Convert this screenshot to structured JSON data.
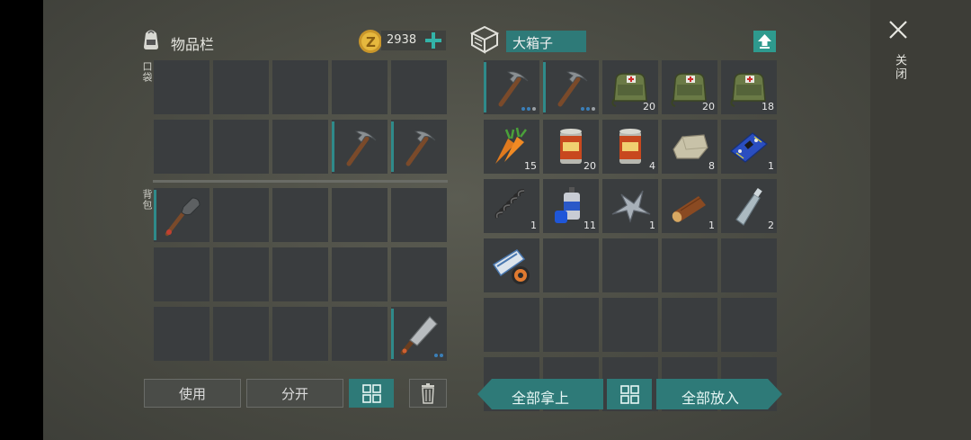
{
  "inventory": {
    "title": "物品栏",
    "coins": "2938",
    "pocket_label": "口袋",
    "backpack_label": "背包",
    "pocket_rows": [
      [
        null,
        null,
        null,
        null,
        null
      ],
      [
        null,
        null,
        null,
        {
          "icon": "pickaxe-icon",
          "dur": true
        },
        {
          "icon": "pickaxe-icon",
          "dur": true
        }
      ]
    ],
    "backpack_rows": [
      [
        {
          "icon": "shovel-icon",
          "dur": true
        },
        null,
        null,
        null,
        null
      ],
      [
        null,
        null,
        null,
        null,
        null
      ],
      [
        null,
        null,
        null,
        null,
        {
          "icon": "cleaver-icon",
          "dur": true,
          "dots": 2
        }
      ]
    ],
    "use_label": "使用",
    "split_label": "分开"
  },
  "container": {
    "title": "大箱子",
    "rows": [
      [
        {
          "icon": "pickaxe-icon",
          "dur": true,
          "dots": 3
        },
        {
          "icon": "pickaxe-icon",
          "dur": true,
          "dots": 3
        },
        {
          "icon": "medkit-bag-icon",
          "count": "20"
        },
        {
          "icon": "medkit-bag-icon",
          "count": "20"
        },
        {
          "icon": "medkit-bag-icon",
          "count": "18"
        }
      ],
      [
        {
          "icon": "carrot-icon",
          "count": "15"
        },
        {
          "icon": "canned-food-icon",
          "count": "20"
        },
        {
          "icon": "canned-food-icon",
          "count": "4"
        },
        {
          "icon": "stone-icon",
          "count": "8"
        },
        {
          "icon": "circuit-board-icon",
          "count": "1"
        }
      ],
      [
        {
          "icon": "spring-icon",
          "count": "1"
        },
        {
          "icon": "spray-can-icon",
          "count": "11"
        },
        {
          "icon": "metal-scrap-icon",
          "count": "1"
        },
        {
          "icon": "wood-log-icon",
          "count": "1"
        },
        {
          "icon": "plastic-bottle-icon",
          "count": "2"
        }
      ],
      [
        {
          "icon": "tape-icon"
        },
        null,
        null,
        null,
        null
      ],
      [
        null,
        null,
        null,
        null,
        null
      ],
      [
        null,
        null,
        null,
        null,
        null
      ]
    ],
    "take_all_label": "全部拿上",
    "put_all_label": "全部放入"
  },
  "close_label": "关闭",
  "colors": {
    "accent": "#2e7a78",
    "slot": "#3a3d3f",
    "durability": "#2f8a8a",
    "dot": "#3a7fb8"
  }
}
